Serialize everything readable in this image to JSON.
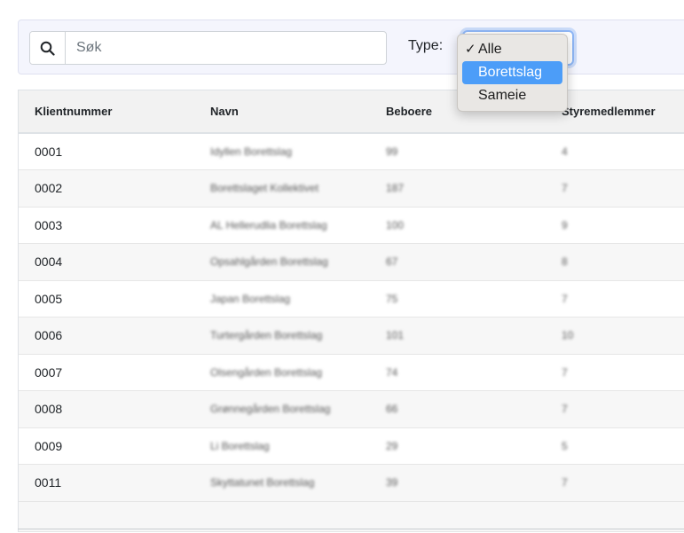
{
  "filter": {
    "search_placeholder": "Søk",
    "search_value": "",
    "search_icon": "search-icon",
    "type_label": "Type:",
    "type_selected": "Alle",
    "type_options": [
      "Alle",
      "Borettslag",
      "Sameie"
    ],
    "type_highlighted": "Borettslag",
    "check_glyph": "✓"
  },
  "table": {
    "headers": [
      "Klientnummer",
      "Navn",
      "Beboere",
      "Styremedlemmer"
    ],
    "rows": [
      [
        "0001",
        "Idyllen Borettslag",
        "99",
        "4"
      ],
      [
        "0002",
        "Borettslaget Kollektivet",
        "187",
        "7"
      ],
      [
        "0003",
        "AL Hellerudlia Borettslag",
        "100",
        "9"
      ],
      [
        "0004",
        "Opsahlgården Borettslag",
        "67",
        "8"
      ],
      [
        "0005",
        "Japan Borettslag",
        "75",
        "7"
      ],
      [
        "0006",
        "Turtergården Borettslag",
        "101",
        "10"
      ],
      [
        "0007",
        "Olsengården Borettslag",
        "74",
        "7"
      ],
      [
        "0008",
        "Grønnegården Borettslag",
        "66",
        "7"
      ],
      [
        "0009",
        "Li Borettslag",
        "29",
        "5"
      ],
      [
        "0011",
        "Skyttatunet Borettslag",
        "39",
        "7"
      ]
    ]
  },
  "colors": {
    "highlight": "#4c9df8",
    "focus_ring": "#8fb7f6",
    "filter_bg": "#f4f5fd"
  }
}
